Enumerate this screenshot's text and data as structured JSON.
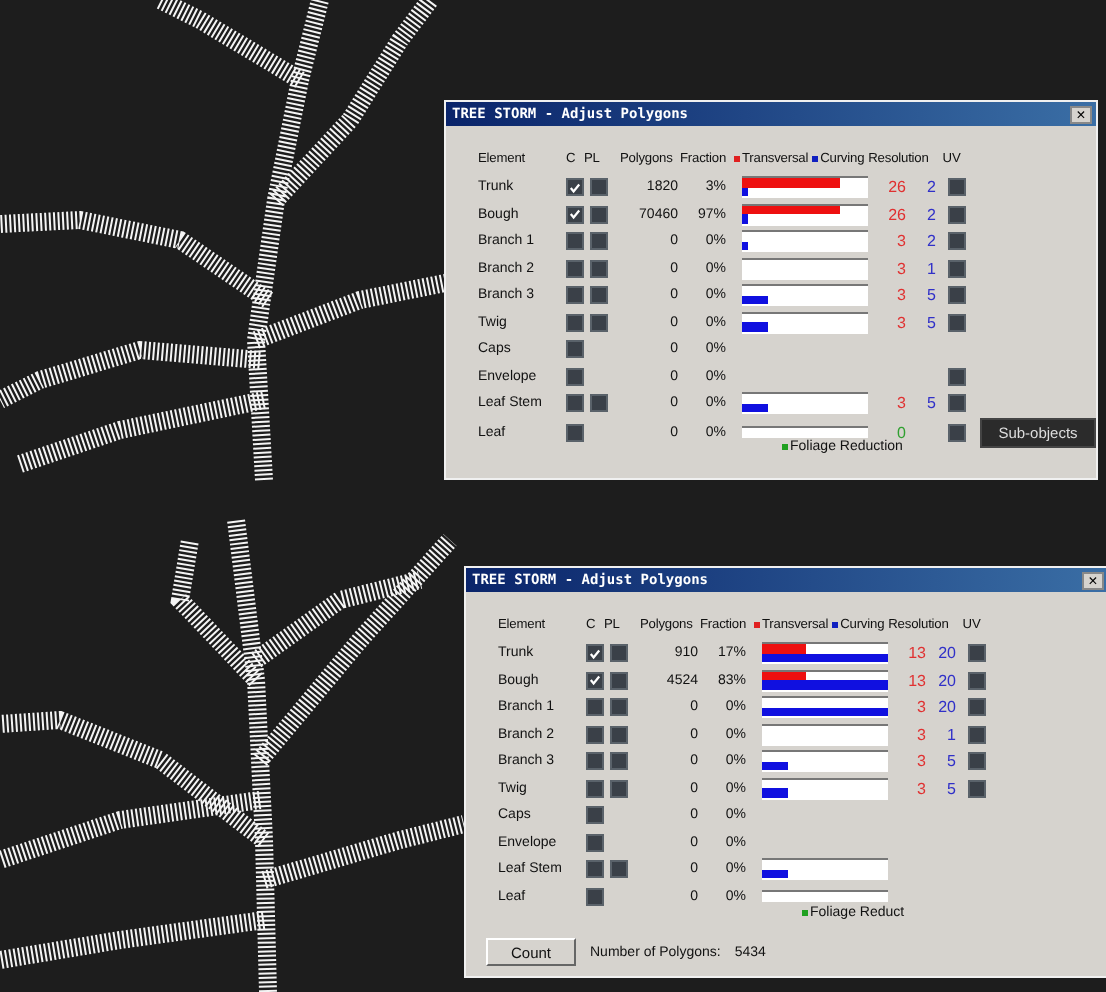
{
  "dialogs": [
    {
      "title": "TREE STORM - Adjust Polygons",
      "close": "×",
      "headers": {
        "element": "Element",
        "c": "C",
        "pl": "PL",
        "polygons": "Polygons",
        "fraction": "Fraction",
        "transversal": "Transversal",
        "curving": "Curving",
        "resolution": "Resolution",
        "uv": "UV"
      },
      "rows": [
        {
          "name": "Trunk",
          "checked": true,
          "pl": true,
          "polygons": "1820",
          "fraction": "3%",
          "bar": {
            "kind": "split",
            "transversal": {
              "level": 0.78
            },
            "curving": {
              "level": 0.04
            }
          },
          "res_transversal": "26",
          "res_curving": "2",
          "uv": true
        },
        {
          "name": "Bough",
          "checked": true,
          "pl": true,
          "polygons": "70460",
          "fraction": "97%",
          "bar": {
            "kind": "split",
            "transversal": {
              "level": 0.78
            },
            "curving": {
              "level": 0.04
            }
          },
          "res_transversal": "26",
          "res_curving": "2",
          "uv": true
        },
        {
          "name": "Branch 1",
          "checked": false,
          "pl": true,
          "polygons": "0",
          "fraction": "0%",
          "bar": {
            "kind": "split",
            "transversal": {
              "level": 0
            },
            "curving": {
              "level": 0.04
            }
          },
          "res_transversal": "3",
          "res_curving": "2",
          "uv": true
        },
        {
          "name": "Branch 2",
          "checked": false,
          "pl": true,
          "polygons": "0",
          "fraction": "0%",
          "bar": {
            "kind": "split",
            "transversal": {
              "level": 0
            },
            "curving": {
              "level": 0
            }
          },
          "res_transversal": "3",
          "res_curving": "1",
          "uv": true
        },
        {
          "name": "Branch 3",
          "checked": false,
          "pl": true,
          "polygons": "0",
          "fraction": "0%",
          "bar": {
            "kind": "split",
            "transversal": {
              "level": 0
            },
            "curving": {
              "level": 0.2
            }
          },
          "res_transversal": "3",
          "res_curving": "5",
          "uv": true
        },
        {
          "name": "Twig",
          "checked": false,
          "pl": true,
          "polygons": "0",
          "fraction": "0%",
          "bar": {
            "kind": "split",
            "transversal": {
              "level": 0
            },
            "curving": {
              "level": 0.2
            }
          },
          "res_transversal": "3",
          "res_curving": "5",
          "uv": true
        },
        {
          "name": "Caps",
          "checked": false,
          "pl": false,
          "polygons": "0",
          "fraction": "0%",
          "uv": false
        },
        {
          "name": "Envelope",
          "checked": false,
          "pl": false,
          "polygons": "0",
          "fraction": "0%",
          "uv": true
        },
        {
          "name": "Leaf Stem",
          "checked": false,
          "pl": true,
          "polygons": "0",
          "fraction": "0%",
          "bar": {
            "kind": "split",
            "transversal": {
              "level": 0
            },
            "curving": {
              "level": 0.2
            }
          },
          "res_transversal": "3",
          "res_curving": "5",
          "uv": true
        },
        {
          "name": "Leaf",
          "checked": false,
          "pl": false,
          "polygons": "0",
          "fraction": "0%",
          "bar": {
            "kind": "foliage",
            "level": 0
          },
          "res_foliage": "0",
          "uv": true,
          "button": "Sub-objects"
        }
      ],
      "foliage_label": "Foliage Reduction"
    },
    {
      "title": "TREE STORM - Adjust Polygons",
      "close": "×",
      "headers": {
        "element": "Element",
        "c": "C",
        "pl": "PL",
        "polygons": "Polygons",
        "fraction": "Fraction",
        "transversal": "Transversal",
        "curving": "Curving",
        "resolution": "Resolution",
        "uv": "UV"
      },
      "rows": [
        {
          "name": "Trunk",
          "checked": true,
          "pl": true,
          "polygons": "910",
          "fraction": "17%",
          "bar": {
            "kind": "split",
            "transversal": {
              "level": 0.35
            },
            "curving": {
              "level": 1
            }
          },
          "res_transversal": "13",
          "res_curving": "20",
          "uv": true
        },
        {
          "name": "Bough",
          "checked": true,
          "pl": true,
          "polygons": "4524",
          "fraction": "83%",
          "bar": {
            "kind": "split",
            "transversal": {
              "level": 0.35
            },
            "curving": {
              "level": 1
            }
          },
          "res_transversal": "13",
          "res_curving": "20",
          "uv": true
        },
        {
          "name": "Branch 1",
          "checked": false,
          "pl": true,
          "polygons": "0",
          "fraction": "0%",
          "bar": {
            "kind": "split",
            "transversal": {
              "level": 0
            },
            "curving": {
              "level": 1
            }
          },
          "res_transversal": "3",
          "res_curving": "20",
          "uv": true
        },
        {
          "name": "Branch 2",
          "checked": false,
          "pl": true,
          "polygons": "0",
          "fraction": "0%",
          "bar": {
            "kind": "split",
            "transversal": {
              "level": 0
            },
            "curving": {
              "level": 0
            }
          },
          "res_transversal": "3",
          "res_curving": "1",
          "uv": true
        },
        {
          "name": "Branch 3",
          "checked": false,
          "pl": true,
          "polygons": "0",
          "fraction": "0%",
          "bar": {
            "kind": "split",
            "transversal": {
              "level": 0
            },
            "curving": {
              "level": 0.2
            }
          },
          "res_transversal": "3",
          "res_curving": "5",
          "uv": true
        },
        {
          "name": "Twig",
          "checked": false,
          "pl": true,
          "polygons": "0",
          "fraction": "0%",
          "bar": {
            "kind": "split",
            "transversal": {
              "level": 0
            },
            "curving": {
              "level": 0.2
            }
          },
          "res_transversal": "3",
          "res_curving": "5",
          "uv": true
        },
        {
          "name": "Caps",
          "checked": false,
          "pl": false,
          "polygons": "0",
          "fraction": "0%",
          "uv": false
        },
        {
          "name": "Envelope",
          "checked": false,
          "pl": false,
          "polygons": "0",
          "fraction": "0%",
          "uv": false
        },
        {
          "name": "Leaf Stem",
          "checked": false,
          "pl": true,
          "polygons": "0",
          "fraction": "0%",
          "bar": {
            "kind": "split",
            "transversal": {
              "level": 0
            },
            "curving": {
              "level": 0.2
            }
          },
          "uv": false
        },
        {
          "name": "Leaf",
          "checked": false,
          "pl": false,
          "polygons": "0",
          "fraction": "0%",
          "bar": {
            "kind": "foliage",
            "level": 0
          },
          "uv": false
        }
      ],
      "foliage_label": "Foliage Reduct",
      "footer": {
        "count_button": "Count",
        "polygons_label": "Number of Polygons:",
        "polygons_value": "5434"
      }
    }
  ]
}
